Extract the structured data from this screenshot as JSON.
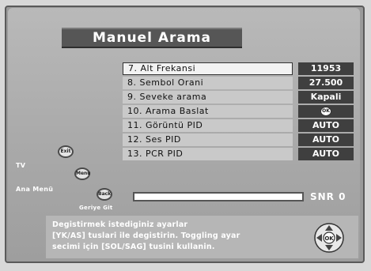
{
  "menu": {
    "title": "Manuel Arama"
  },
  "rows": [
    {
      "label": "7. Alt Frekansi",
      "value": "11953",
      "selected": true
    },
    {
      "label": "8. Sembol Orani",
      "value": "27.500"
    },
    {
      "label": "9. Seveke arama",
      "value": "Kapali"
    },
    {
      "label": "10. Arama Baslat",
      "value": "OK",
      "value_is_icon": true
    },
    {
      "label": "11. Görüntü PID",
      "value": "AUTO"
    },
    {
      "label": "12. Ses PID",
      "value": "AUTO"
    },
    {
      "label": "13. PCR PID",
      "value": "AUTO"
    }
  ],
  "side_buttons": {
    "exit": {
      "icon_text": "Exit",
      "label": "TV"
    },
    "menu": {
      "icon_text": "Menu",
      "label": "Ana Menü"
    },
    "back": {
      "icon_text": "Back",
      "label": "Geriye Git"
    }
  },
  "signal": {
    "snr_label": "SNR",
    "snr_value": "0",
    "snr_level": 0
  },
  "help": {
    "line1": "Degistirmek istediginiz ayarlar",
    "line2": "[YK/AS] tuslari ile degistirin. Toggling ayar",
    "line3": "secimi için [SOL/SAG] tusini kullanin."
  },
  "icons": {
    "navigation_pad": "dpad-icon",
    "ok_button": "ok-icon"
  }
}
